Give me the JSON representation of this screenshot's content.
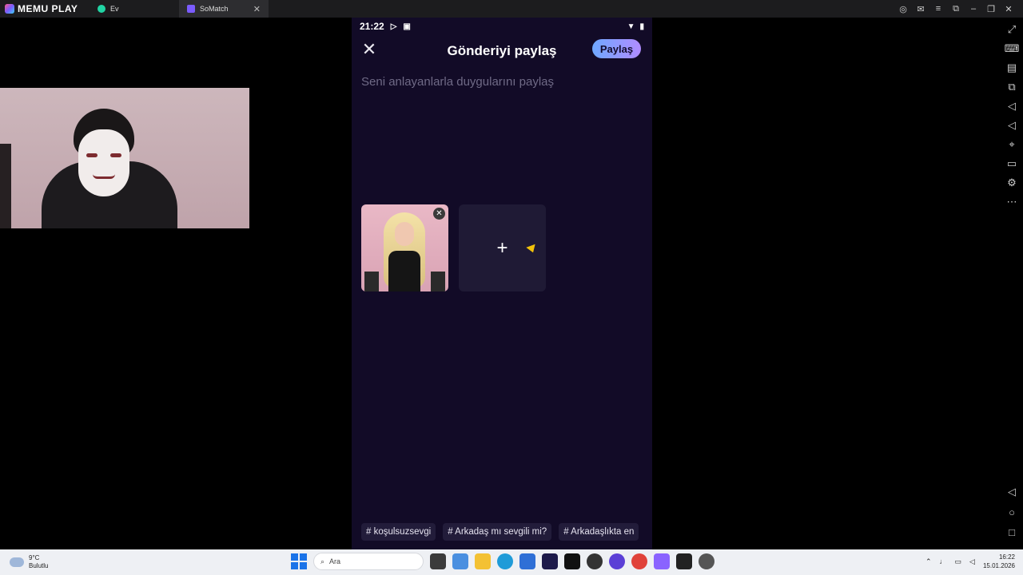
{
  "emulator": {
    "brand": "MEMU PLAY",
    "tabs": [
      {
        "label": "Ev"
      },
      {
        "label": "SoMatch"
      }
    ]
  },
  "phone": {
    "status": {
      "time": "21:22"
    },
    "header": {
      "title": "Gönderiyi paylaş",
      "share_label": "Paylaş"
    },
    "post": {
      "placeholder": "Seni anlayanlarla duygularını paylaş",
      "add_media_label": "+"
    },
    "hashtags": [
      "# koşulsuzsevgi",
      "# Arkadaş mı sevgili mi?",
      "# Arkadaşlıkta en"
    ]
  },
  "taskbar": {
    "weather": {
      "temp": "9°C",
      "condition": "Bulutlu"
    },
    "search_placeholder": "Ara",
    "clock": {
      "time": "16:22",
      "date": "15.01.2026"
    }
  },
  "colors": {
    "phone_bg": "#120b27",
    "share_gradient_start": "#6fa8ff",
    "share_gradient_end": "#b08cff",
    "chip_bg": "#221c3a"
  }
}
